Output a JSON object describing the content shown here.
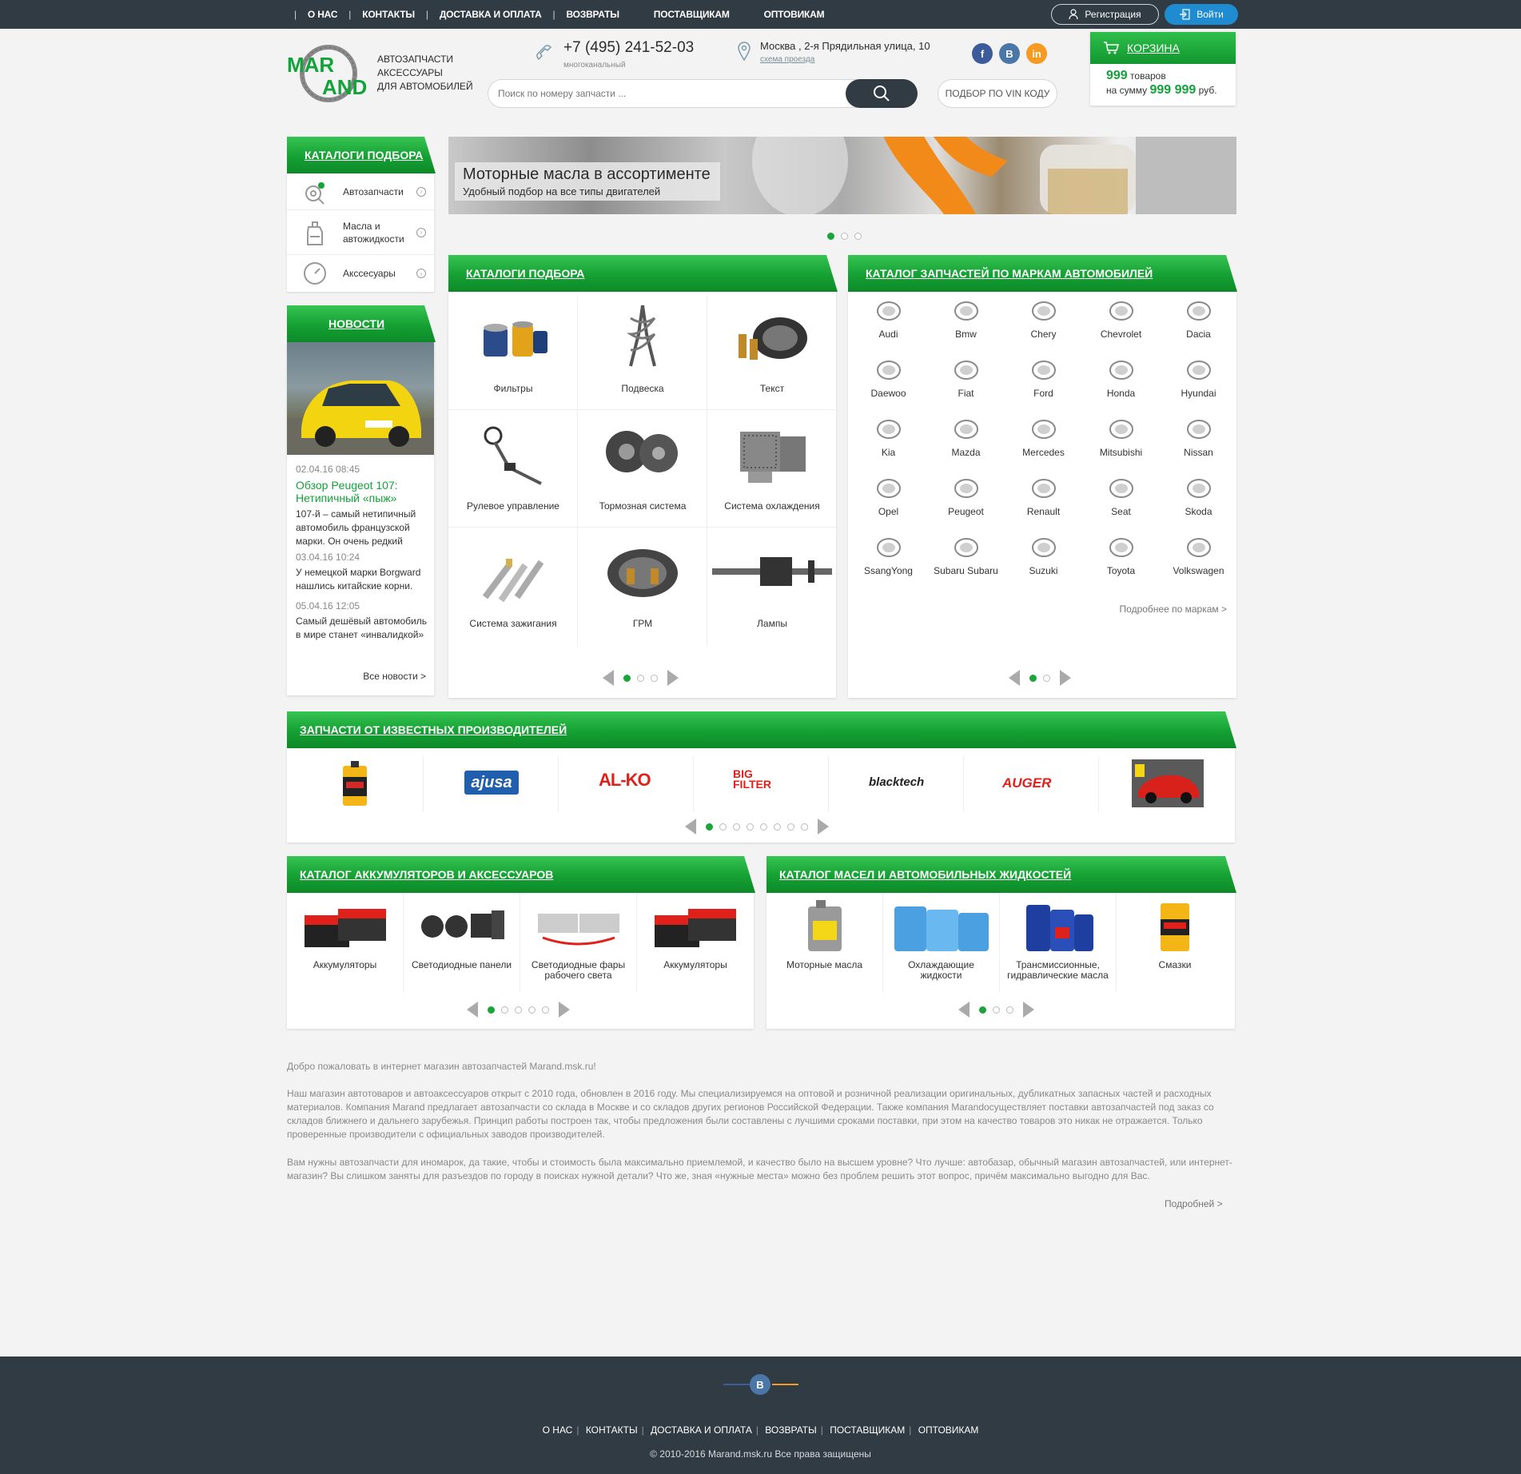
{
  "topnav": {
    "items": [
      "О НАС",
      "КОНТАКТЫ",
      "ДОСТАВКА И ОПЛАТА",
      "ВОЗВРАТЫ",
      "ПОСТАВЩИКАМ",
      "ОПТОВИКАМ"
    ],
    "register": "Регистрация",
    "login": "Войти"
  },
  "header": {
    "logo_line1": "MAR",
    "logo_line2": "AND",
    "tagline": [
      "АВТОЗАПЧАСТИ",
      "АКСЕССУАРЫ",
      "ДЛЯ АВТОМОБИЛЕЙ"
    ],
    "phone": "+7 (495) 241-52-03",
    "phone_note": "многоканальный",
    "address": "Москва , 2-я Прядильная улица, 10",
    "address_link": "схема проезда",
    "social": [
      "f",
      "B",
      "in"
    ],
    "search_placeholder": "Поиск по номеру запчасти ...",
    "vin_button": "ПОДБОР ПО VIN КОДУ",
    "cart_title": "КОРЗИНА",
    "cart_count": "999",
    "cart_count_label": "товаров",
    "cart_sum_prefix": "на сумму",
    "cart_sum": "999 999",
    "cart_currency": "руб."
  },
  "left_catalog": {
    "title": "КАТАЛОГИ ПОДБОРА",
    "items": [
      {
        "label": "Автозапчасти",
        "icon": "gear-search-icon"
      },
      {
        "label": "Масла и автожидкости",
        "icon": "oil-can-icon"
      },
      {
        "label": "Акссесуары",
        "icon": "speedometer-icon"
      }
    ]
  },
  "news": {
    "title": "НОВОСТИ",
    "items": [
      {
        "date": "02.04.16 08:45",
        "headline": "Обзор Peugeot 107: Нетипичный «пыж»",
        "text": "107-й – самый нетипичный автомобиль французской марки. Он очень редкий"
      },
      {
        "date": "03.04.16 10:24",
        "text": "У немецкой марки Borgward нашлись китайские корни."
      },
      {
        "date": "05.04.16 12:05",
        "text": "Самый дешёвый автомобиль в мире станет «инвалидкой»"
      }
    ],
    "all_link": "Все новости  >"
  },
  "banner": {
    "title": "Моторные масла в ассортименте",
    "subtitle": "Удобный подбор на все типы двигателей"
  },
  "catalog": {
    "title": "КАТАЛОГИ ПОДБОРА",
    "items": [
      "Фильтры",
      "Подвеска",
      "Текст",
      "Рулевое управление",
      "Тормозная система",
      "Система охлаждения",
      "Система зажигания",
      "ГРМ",
      "Лампы"
    ]
  },
  "brands": {
    "title": "КАТАЛОГ ЗАПЧАСТЕЙ ПО МАРКАМ АВТОМОБИЛЕЙ",
    "items": [
      "Audi",
      "Bmw",
      "Chery",
      "Chevrolet",
      "Dacia",
      "Daewoo",
      "Fiat",
      "Ford",
      "Honda",
      "Hyundai",
      "Kia",
      "Mazda",
      "Mercedes",
      "Mitsubishi",
      "Nissan",
      "Opel",
      "Peugeot",
      "Renault",
      "Seat",
      "Skoda",
      "SsangYong",
      "Subaru Subaru",
      "Suzuki",
      "Toyota",
      "Volkswagen"
    ],
    "more_link": "Подробнее по маркам  >"
  },
  "manufacturers": {
    "title": "ЗАПЧАСТИ ОТ ИЗВЕСТНЫХ ПРОИЗВОДИТЕЛЕЙ",
    "logos": [
      "ajusa",
      "AL-KO",
      "BIG FILTER",
      "blacktech",
      "AUGER"
    ]
  },
  "batteries": {
    "title": "КАТАЛОГ АККУМУЛЯТОРОВ И АКСЕССУАРОВ",
    "items": [
      "Аккумуляторы",
      "Светодиодные панели",
      "Светодиодные фары рабочего света",
      "Аккумуляторы"
    ]
  },
  "oils": {
    "title": "КАТАЛОГ МАСЕЛ И АВТОМОБИЛЬНЫХ ЖИДКОСТЕЙ",
    "items": [
      "Моторные масла",
      "Охлаждающие жидкости",
      "Трансмиссионные, гидравлические масла",
      "Смазки"
    ]
  },
  "about": {
    "p1": "Добро пожаловать в интернет магазин автозапчастей Marand.msk.ru!",
    "p2": "Наш магазин автотоваров и автоаксессуаров открыт с 2010 года, обновлен в 2016 году. Мы специализируемся на оптовой и розничной реализации оригинальных, дубликатных запасных частей и расходных материалов. Компания Marand предлагает автозапчасти со склада в Москве и со складов других регионов Российской Федерации. Также компания Marandосуществляет поставки автозапчастей под заказ со складов ближнего и дальнего зарубежья. Принцип работы построен так, чтобы предложения были составлены с лучшими сроками поставки, при этом на качество товаров это никак не отражается. Только проверенные производители с официальных заводов производителей.",
    "p3": "Вам нужны автозапчасти для иномарок, да такие, чтобы и стоимость была максимально приемлемой, и качество было на высшем уровне? Что лучше: автобазар, обычный магазин автозапчастей, или интернет-магазин? Вы слишком заняты для разъездов по городу в поисках нужной детали? Что же, зная «нужные места» можно без проблем решить этот вопрос, причём максимально выгодно для Вас.",
    "more": "Подробней  >"
  },
  "footer": {
    "social": "B",
    "nav": [
      "О НАС",
      "КОНТАКТЫ",
      "ДОСТАВКА И ОПЛАТА",
      "ВОЗВРАТЫ",
      "ПОСТАВЩИКАМ",
      "ОПТОВИКАМ"
    ],
    "copyright": "© 2010-2016 Marand.msk.ru Все права защищены"
  },
  "colors": {
    "accent": "#13a33a",
    "dark": "#313b44",
    "blue": "#1f8bd0"
  }
}
